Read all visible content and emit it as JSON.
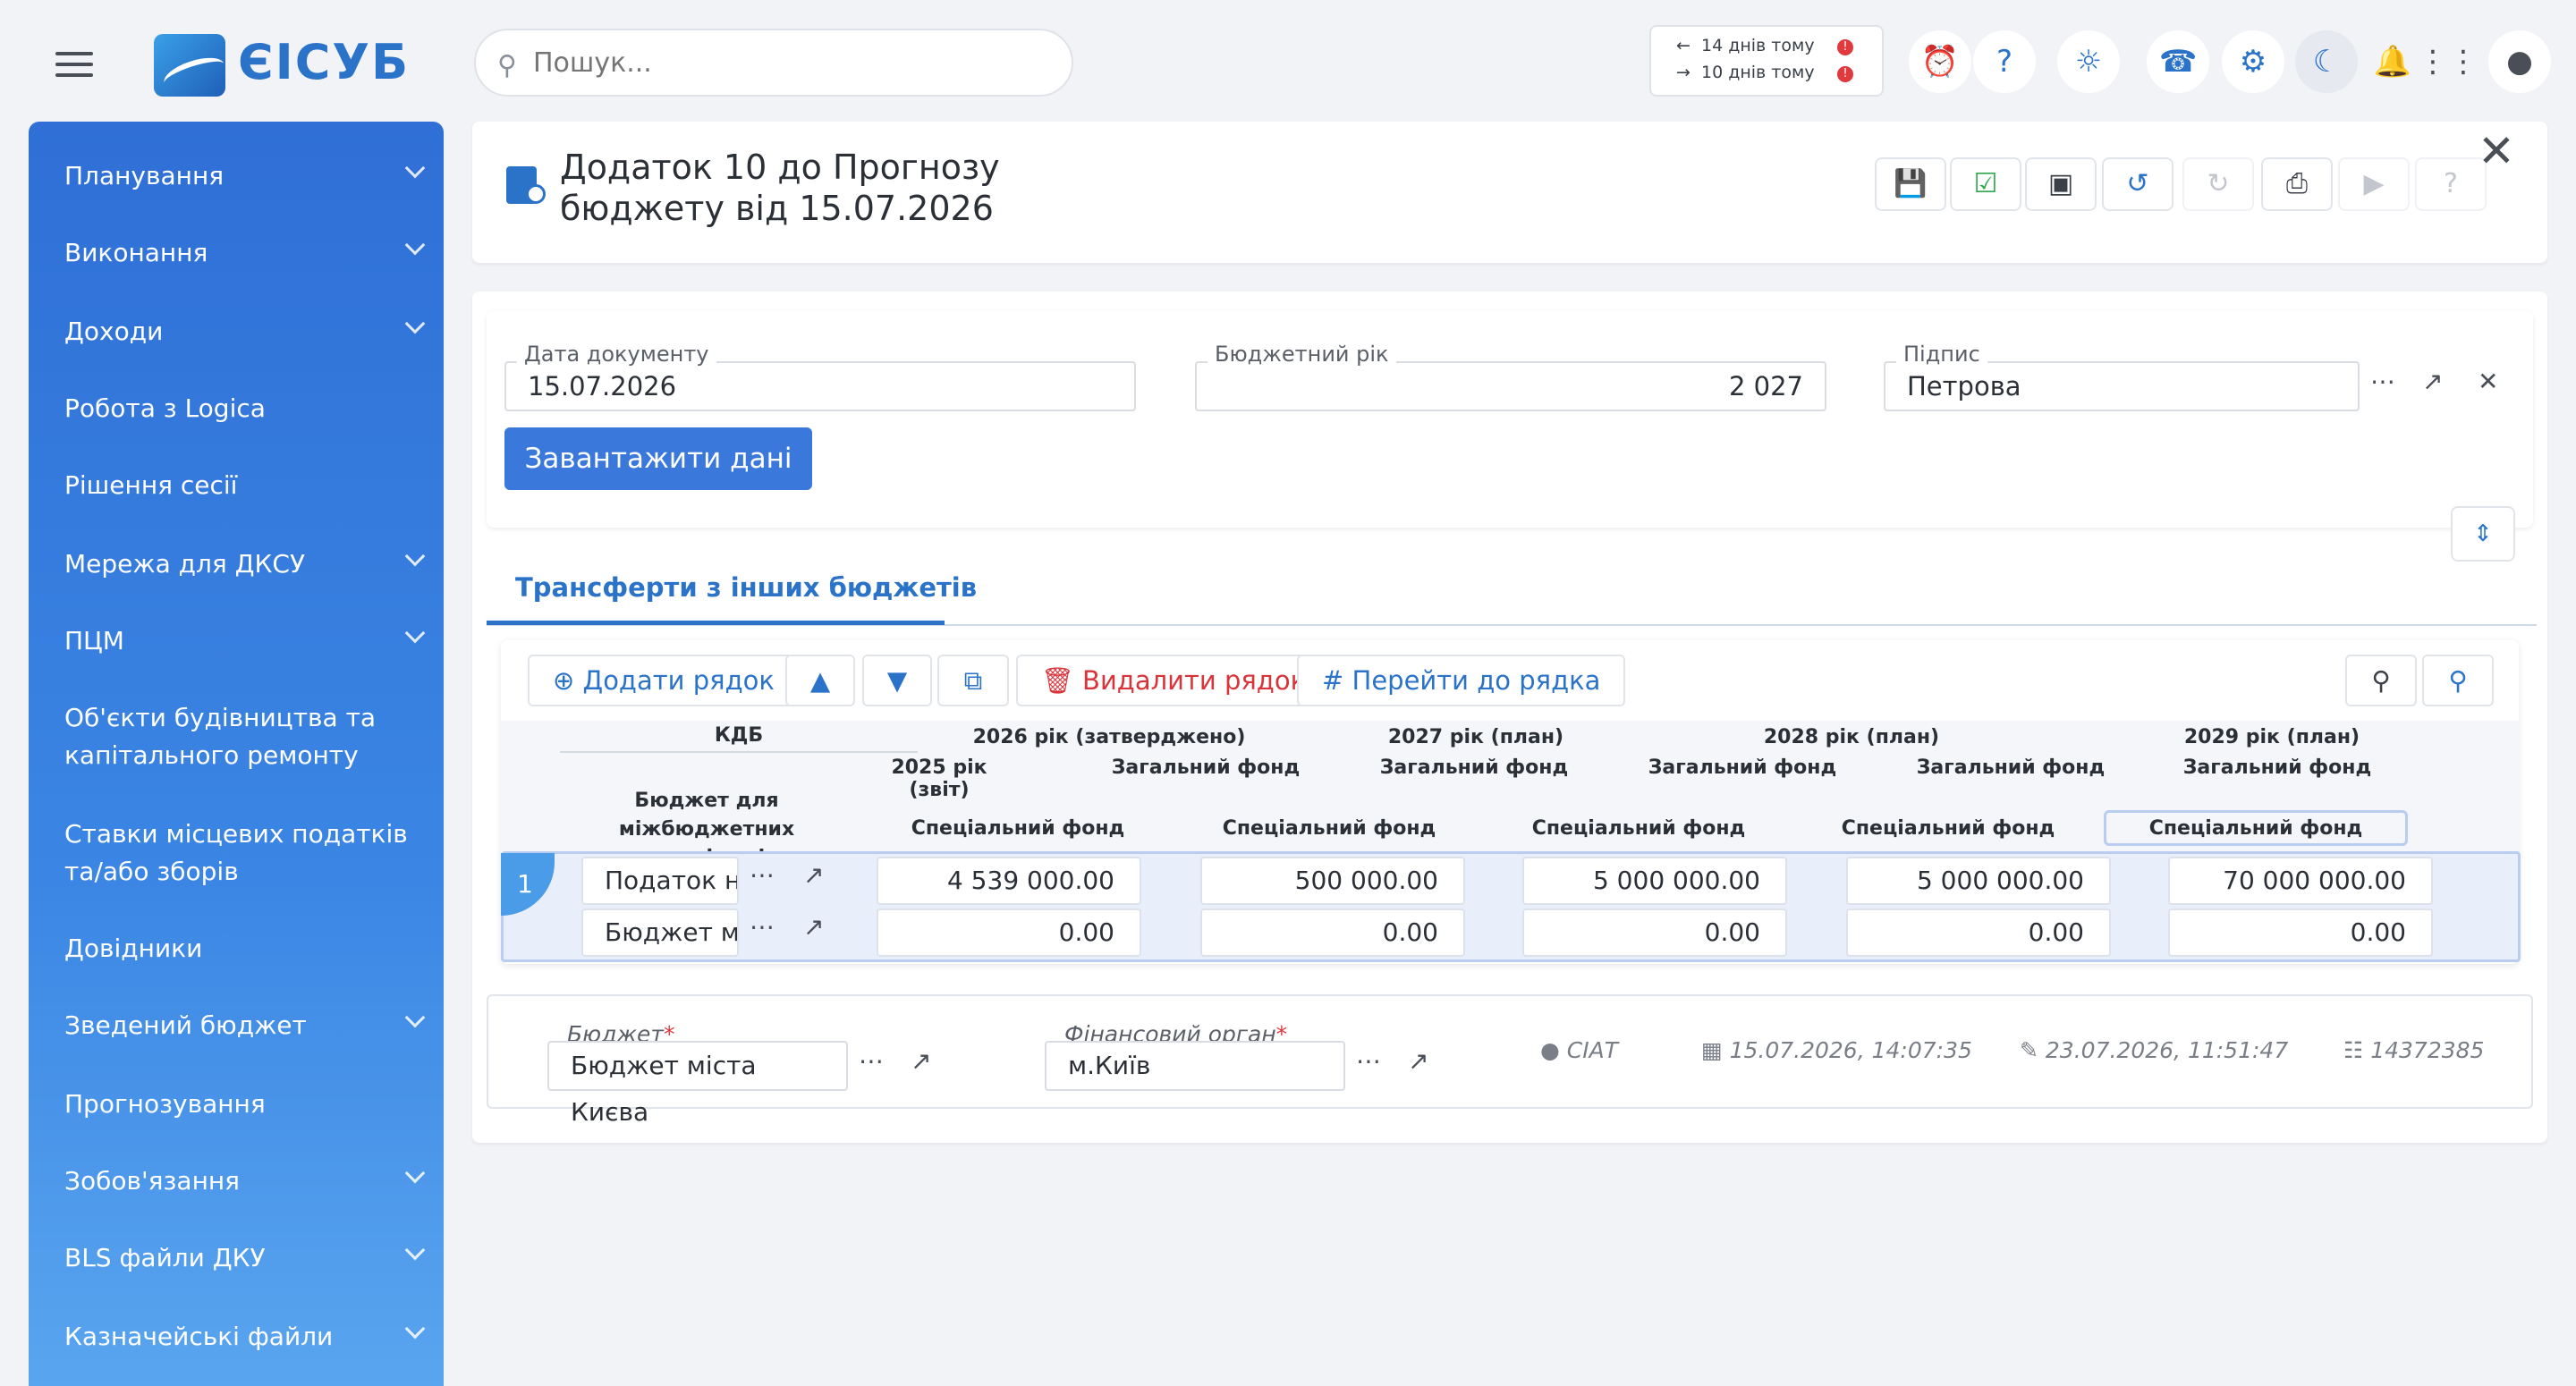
{
  "app": {
    "logo_text": "ЄІСУБ"
  },
  "search": {
    "placeholder": "Пошук..."
  },
  "history": {
    "back": "14 днів тому",
    "forward": "10 днів тому"
  },
  "sidebar": {
    "items": [
      {
        "label": "Планування"
      },
      {
        "label": "Виконання"
      },
      {
        "label": "Доходи"
      },
      {
        "label": "Робота з Logica"
      },
      {
        "label": "Рішення сесії"
      },
      {
        "label": "Мережа для ДКСУ"
      },
      {
        "label": "ПЦМ"
      },
      {
        "label": "Об'єкти будівництва та капітального ремонту"
      },
      {
        "label": "Ставки місцевих податків та/або зборів"
      },
      {
        "label": "Довідники"
      },
      {
        "label": "Зведений бюджет"
      },
      {
        "label": "Прогнозування"
      },
      {
        "label": "Зобов'язання"
      },
      {
        "label": "BLS файли ДКУ"
      },
      {
        "label": "Казначейські файли"
      }
    ]
  },
  "document": {
    "title_line1": "Додаток 10 до Прогнозу",
    "title_line2": "бюджету від 15.07.2026",
    "fields": {
      "date_label": "Дата документу",
      "date_value": "15.07.2026",
      "year_label": "Бюджетний рік",
      "year_value": "2 027",
      "sign_label": "Підпис",
      "sign_value": "Петрова"
    },
    "load_button": "Завантажити дані"
  },
  "tabs": [
    {
      "label": "Трансферти з інших бюджетів"
    }
  ],
  "grid_toolbar": {
    "add_row": "Додати рядок",
    "delete_row": "Видалити рядок",
    "goto_row": "Перейти до рядка"
  },
  "table": {
    "headers": {
      "kdb": "КДБ",
      "budget": "Бюджет для міжбюджетних трансфертів",
      "y2025": "2025 рік (звіт)",
      "y2026": "2026 рік (затверджено)",
      "y2027": "2027 рік (план)",
      "y2028": "2028 рік (план)",
      "y2029": "2029 рік (план)",
      "general_fund": "Загальний фонд",
      "special_fund": "Спеціальний фонд"
    },
    "row_number": "1",
    "rows": [
      {
        "name": "Податок на доходи",
        "values": [
          "4 539 000.00",
          "500 000.00",
          "5 000 000.00",
          "5 000 000.00",
          "70 000 000.00"
        ]
      },
      {
        "name": "Бюджет міста Києва",
        "values": [
          "0.00",
          "0.00",
          "0.00",
          "0.00",
          "0.00"
        ]
      }
    ]
  },
  "footer": {
    "budget_label": "Бюджет",
    "budget_value": "Бюджет міста Києва",
    "fin_label": "Фінансовий орган",
    "fin_value": "м.Київ",
    "user": "СІАТ",
    "created": "15.07.2026, 14:07:35",
    "modified": "23.07.2026, 11:51:47",
    "doc_id": "14372385"
  },
  "colors": {
    "accent": "#2a73c9",
    "primary_button": "#3a78dc",
    "sidebar_top": "#2f6fd6",
    "sidebar_bottom": "#5aa5ef",
    "danger": "#e0393e"
  }
}
